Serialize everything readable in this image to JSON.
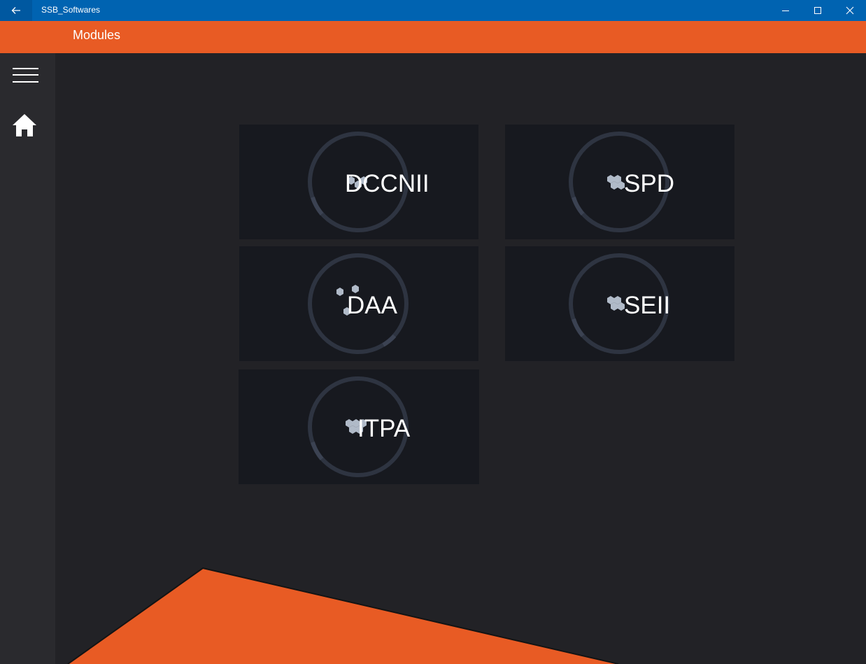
{
  "window": {
    "title": "SSB_Softwares",
    "controls": [
      "minimize-icon",
      "maximize-icon",
      "close-icon"
    ]
  },
  "header": {
    "title": "Modules"
  },
  "sidebar": {
    "items": [
      "hamburger-menu-icon",
      "home-icon"
    ]
  },
  "colors": {
    "titlebar": "#0063b1",
    "accent": "#e85b24",
    "background": "#222226",
    "sidebar": "#2a2a2e",
    "tile": "#17191f",
    "ring": "#2e3441"
  },
  "modules": [
    {
      "label": "DCCNII"
    },
    {
      "label": "SPD"
    },
    {
      "label": "DAA"
    },
    {
      "label": "SEII"
    },
    {
      "label": "ITPA"
    }
  ]
}
